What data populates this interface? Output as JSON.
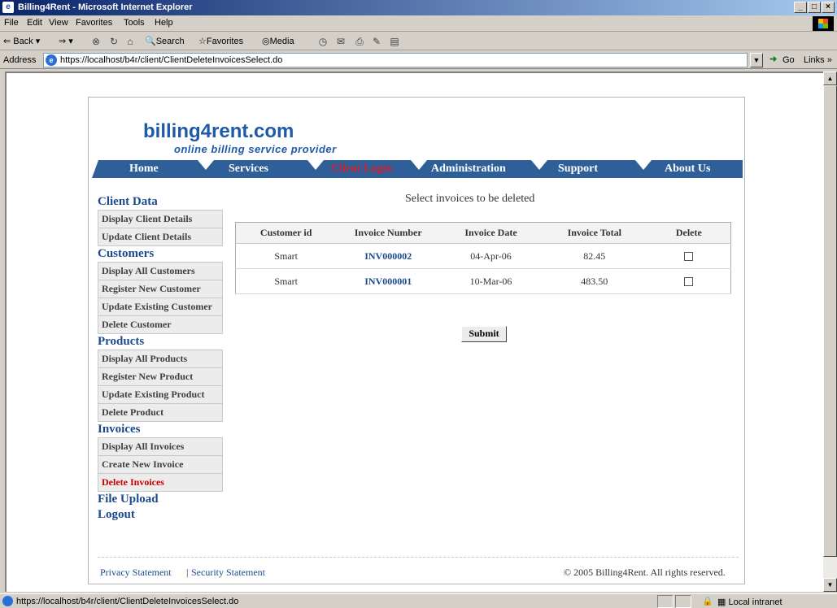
{
  "window": {
    "title": "Billing4Rent - Microsoft Internet Explorer",
    "controls": [
      "_",
      "□",
      "×"
    ]
  },
  "menu": [
    "File",
    "Edit",
    "View",
    "Favorites",
    "Tools",
    "Help"
  ],
  "toolbar": {
    "back": "Back",
    "search": "Search",
    "favorites": "Favorites",
    "media": "Media"
  },
  "address": {
    "label": "Address",
    "url": "https://localhost/b4r/client/ClientDeleteInvoicesSelect.do",
    "go": "Go",
    "links": "Links »"
  },
  "status": {
    "url": "https://localhost/b4r/client/ClientDeleteInvoicesSelect.do",
    "zone": "Local intranet"
  },
  "logo": {
    "name": "billing4rent.com",
    "tagline": "online billing service provider"
  },
  "nav": [
    {
      "label": "Home",
      "active": false
    },
    {
      "label": "Services",
      "active": false
    },
    {
      "label": "Client Login",
      "active": true
    },
    {
      "label": "Administration",
      "active": false
    },
    {
      "label": "Support",
      "active": false
    },
    {
      "label": "About Us",
      "active": false
    }
  ],
  "sidebar": {
    "client_data": {
      "title": "Client Data",
      "links": [
        "Display Client Details",
        "Update Client Details"
      ]
    },
    "customers": {
      "title": "Customers",
      "links": [
        "Display All Customers",
        "Register New Customer",
        "Update Existing Customer",
        "Delete Customer"
      ]
    },
    "products": {
      "title": "Products",
      "links": [
        "Display All Products",
        "Register New Product",
        "Update Existing Product",
        "Delete Product"
      ]
    },
    "invoices": {
      "title": "Invoices",
      "links": [
        "Display All Invoices",
        "Create New Invoice",
        "Delete Invoices"
      ]
    },
    "file_upload": "File Upload",
    "logout": "Logout"
  },
  "content": {
    "title": "Select invoices to be deleted",
    "columns": [
      "Customer id",
      "Invoice Number",
      "Invoice Date",
      "Invoice Total",
      "Delete"
    ],
    "rows": [
      {
        "customer": "Smart",
        "invoice": "INV000002",
        "date": "04-Apr-06",
        "total": "82.45",
        "delete": false
      },
      {
        "customer": "Smart",
        "invoice": "INV000001",
        "date": "10-Mar-06",
        "total": "483.50",
        "delete": false
      }
    ],
    "submit": "Submit"
  },
  "footer": {
    "privacy": "Privacy Statement",
    "separator": "|",
    "security": "Security Statement",
    "copyright": "© 2005 Billing4Rent. All rights reserved."
  },
  "colors": {
    "nav_bar": "#2e5f99",
    "link_blue": "#1b4a8c",
    "active_red": "#cc0000"
  }
}
